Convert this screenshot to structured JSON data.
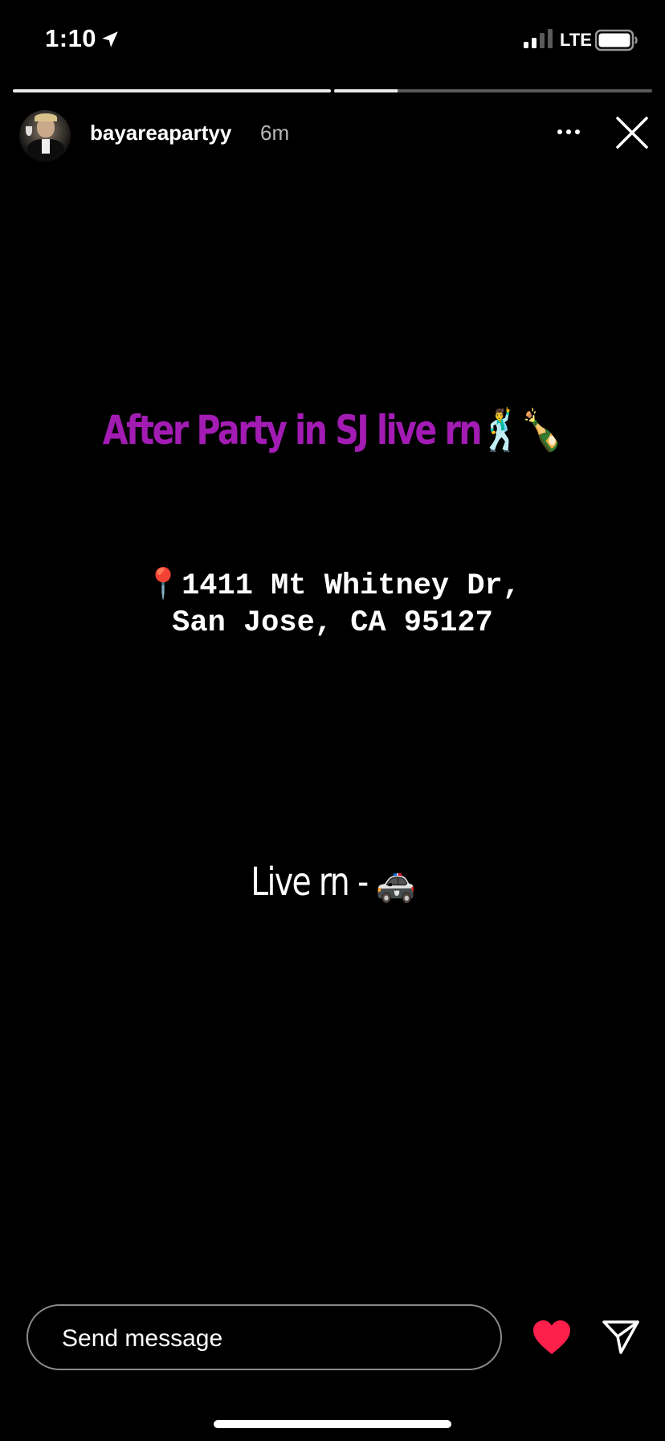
{
  "status_bar": {
    "time": "1:10",
    "network": "LTE",
    "icons": [
      "location-arrow-icon",
      "signal-icon",
      "battery-icon"
    ]
  },
  "story": {
    "progress": [
      1.0,
      0.2
    ],
    "username": "bayareapartyy",
    "timestamp": "6m",
    "headline": "After Party in SJ live rn",
    "headline_emoji": "🕺🍾",
    "address_line1": "📍1411 Mt Whitney Dr,",
    "address_line2": "San Jose, CA 95127",
    "live_text": "Live rn -",
    "live_emoji": "🚓",
    "headline_color": "#a21cb3"
  },
  "reply_bar": {
    "placeholder": "Send message",
    "icons": [
      "heart-icon",
      "send-icon"
    ],
    "heart_color": "#ff1f4b"
  }
}
